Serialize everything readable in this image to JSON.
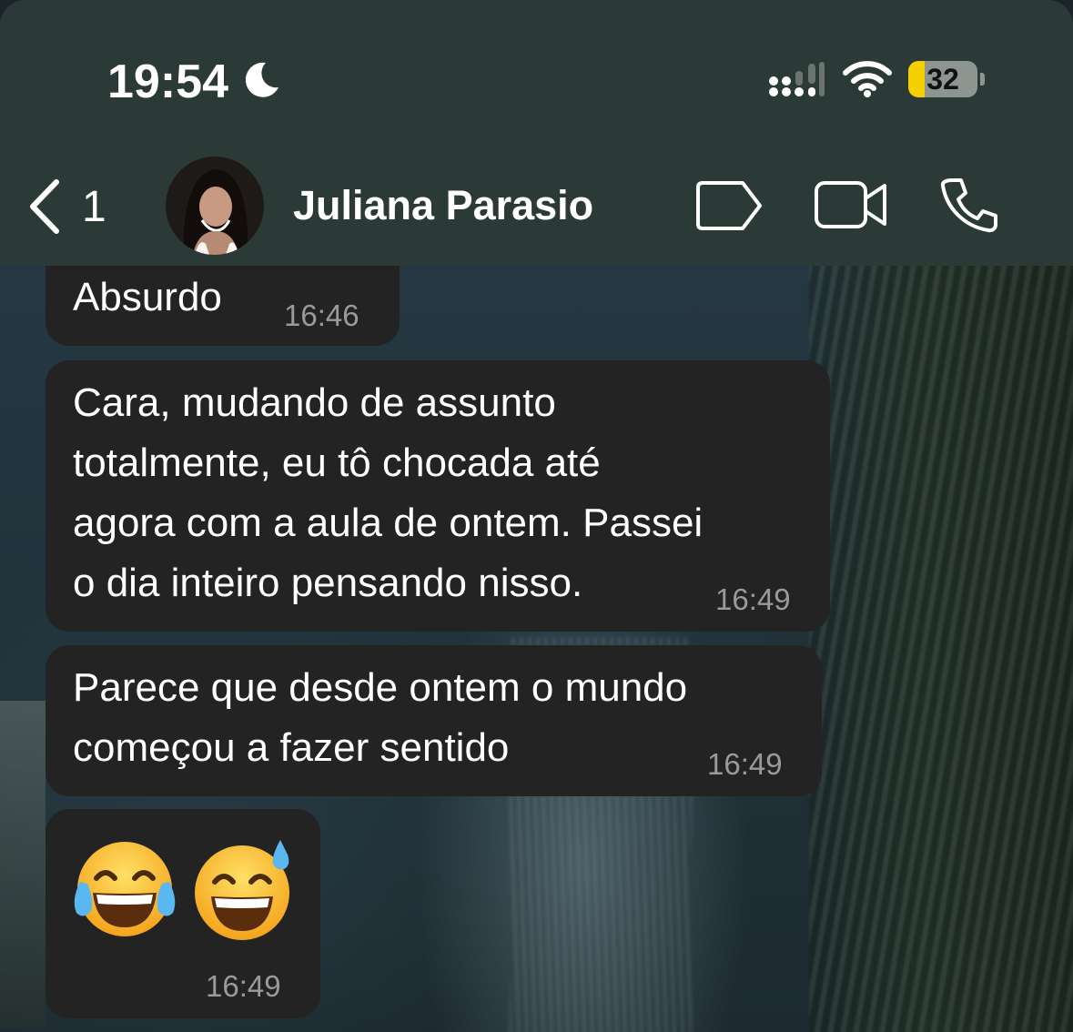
{
  "status_bar": {
    "time": "19:54",
    "battery": "32",
    "icons": [
      "moon-icon",
      "signal-icon",
      "wifi-icon",
      "battery-icon"
    ]
  },
  "header": {
    "back_count": "1",
    "contact_name": "Juliana Parasio",
    "icons": [
      "chevron-left-icon",
      "label-tag-icon",
      "video-camera-icon",
      "phone-icon"
    ]
  },
  "messages": [
    {
      "text": "Absurdo",
      "time": "16:46"
    },
    {
      "text": "Cara, mudando de assunto\ntotalmente, eu tô chocada até\nagora com a aula de ontem. Passei\no dia inteiro pensando nisso.",
      "time": "16:49"
    },
    {
      "text": "Parece que desde ontem o mundo\ncomeçou a fazer sentido",
      "time": "16:49"
    },
    {
      "emojis": [
        "face-with-tears-of-joy",
        "grinning-face-with-sweat"
      ],
      "time": "16:49"
    }
  ],
  "colors": {
    "header_bg": "#2c3a37",
    "bubble_bg": "#232323",
    "battery_fill": "#f5d000"
  }
}
